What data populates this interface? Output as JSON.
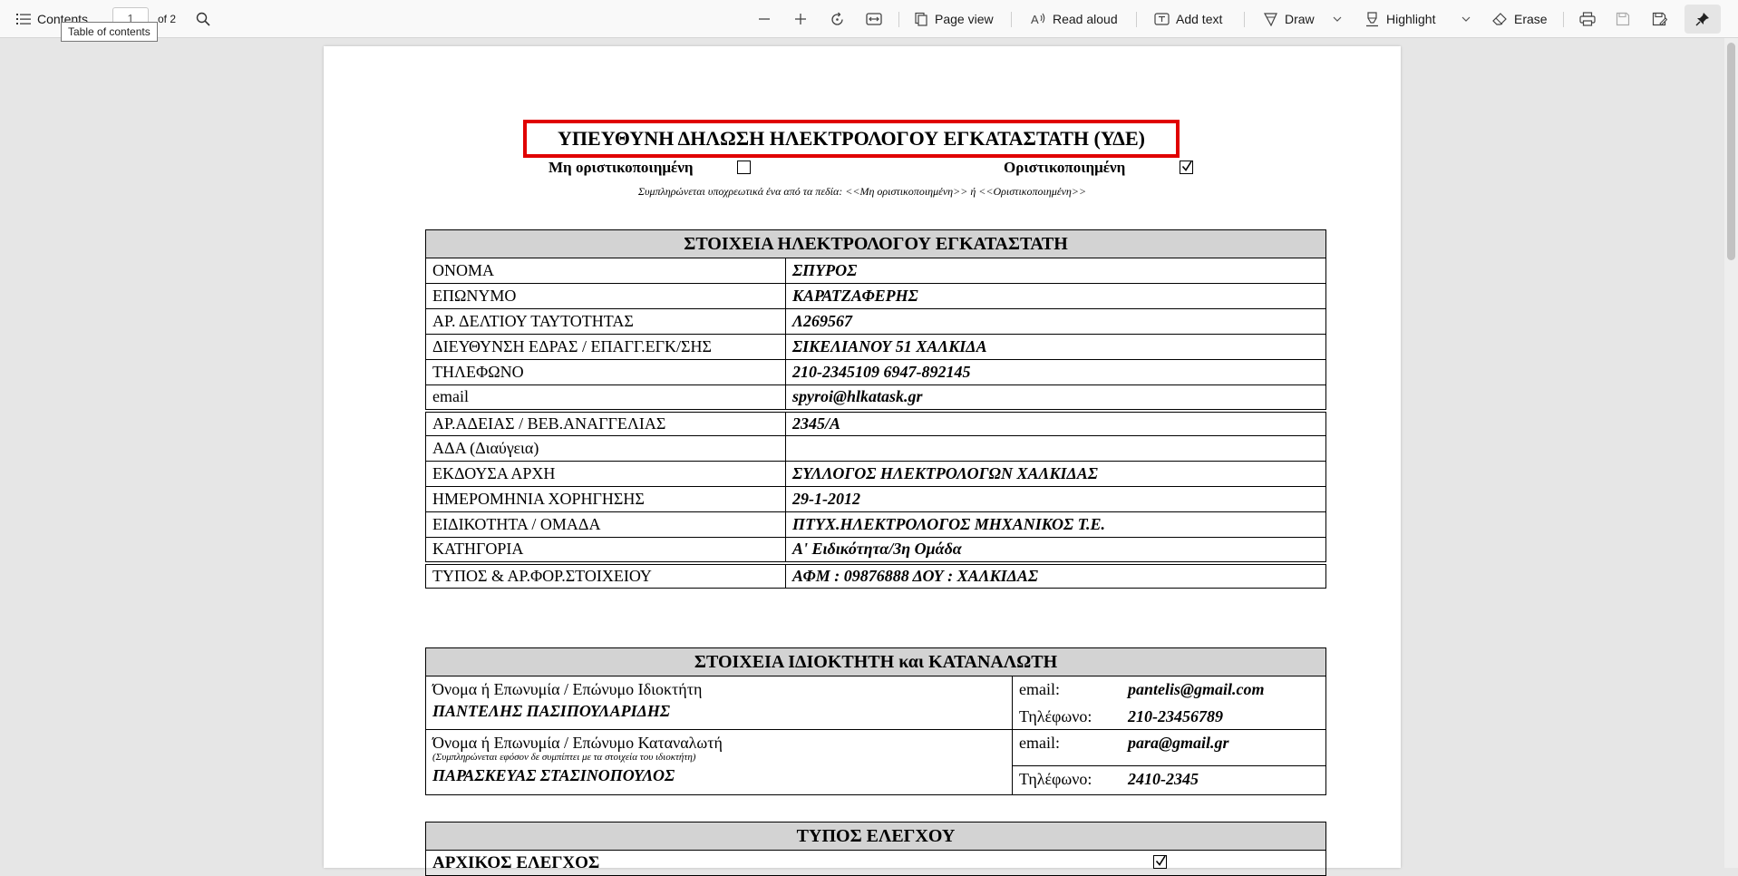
{
  "toolbar": {
    "contents_label": "Contents",
    "page_current": "1",
    "page_total": "of 2",
    "page_view": "Page view",
    "read_aloud": "Read aloud",
    "add_text": "Add text",
    "draw": "Draw",
    "highlight": "Highlight",
    "erase": "Erase",
    "tooltip": "Table of contents"
  },
  "doc": {
    "title": "ΥΠΕΥΘΥΝΗ ΔΗΛΩΣΗ ΗΛΕΚΤΡΟΛΟΓΟΥ ΕΓΚΑΤΑΣΤΑΤΗ (ΥΔΕ)",
    "not_finalized": "Μη οριστικοποιημένη",
    "finalized": "Οριστικοποιημένη",
    "fill_note": "Συμπληρώνεται υποχρεωτικά ένα από τα πεδία: <<Μη οριστικοποιημένη>> ή <<Οριστικοποιημένη>>",
    "installer": {
      "header": "ΣΤΟΙΧΕΙΑ ΗΛΕΚΤΡΟΛΟΓΟΥ ΕΓΚΑΤΑΣΤΑΤΗ",
      "rows": [
        {
          "label": "ΟΝΟΜΑ",
          "value": "ΣΠΥΡΟΣ"
        },
        {
          "label": "ΕΠΩΝΥΜΟ",
          "value": "ΚΑΡΑΤΖΑΦΕΡΗΣ"
        },
        {
          "label": "ΑΡ. ΔΕΛΤΙΟΥ ΤΑΥΤΟΤΗΤΑΣ",
          "value": "Λ269567"
        },
        {
          "label": "ΔΙΕΥΘΥΝΣΗ ΕΔΡΑΣ / ΕΠΑΓΓ.ΕΓΚ/ΣΗΣ",
          "value": "ΣΙΚΕΛΙΑΝΟΥ 51 ΧΑΛΚΙΔΑ"
        },
        {
          "label": "ΤΗΛΕΦΩΝΟ",
          "value": "210-2345109  6947-892145"
        },
        {
          "label": "email",
          "value": "spyroi@hlkatask.gr"
        },
        {
          "label": "ΑΡ.ΑΔΕΙΑΣ / ΒΕΒ.ΑΝΑΓΓΕΛΙΑΣ",
          "value": "2345/Α"
        },
        {
          "label": "ΑΔΑ (Διαύγεια)",
          "value": ""
        },
        {
          "label": "ΕΚΔΟΥΣΑ ΑΡΧΗ",
          "value": "ΣΥΛΛΟΓΟΣ ΗΛΕΚΤΡΟΛΟΓΩΝ ΧΑΛΚΙΔΑΣ"
        },
        {
          "label": "ΗΜΕΡΟΜΗΝΙΑ ΧΟΡΗΓΗΣΗΣ",
          "value": "29-1-2012"
        },
        {
          "label": "ΕΙΔΙΚΟΤΗΤΑ / ΟΜΑΔΑ",
          "value": "ΠΤΥΧ.ΗΛΕΚΤΡΟΛΟΓΟΣ ΜΗΧΑΝΙΚΟΣ Τ.Ε."
        },
        {
          "label": "ΚΑΤΗΓΟΡΙΑ",
          "value": "Α' Ειδικότητα/3η Ομάδα"
        },
        {
          "label": "ΤΥΠΟΣ & ΑΡ.ΦΟΡ.ΣΤΟΙΧΕΙΟΥ",
          "value": "ΑΦΜ : 09876888  ΔΟΥ : ΧΑΛΚΙΔΑΣ"
        }
      ]
    },
    "owner": {
      "header": "ΣΤΟΙΧΕΙΑ ΙΔΙΟΚΤΗΤΗ και ΚΑΤΑΝΑΛΩΤΗ",
      "owner_label": "Όνομα ή Επωνυμία / Επώνυμο Ιδιοκτήτη",
      "owner_name": "ΠΑΝΤΕΛΗΣ ΠΑΣΙΠΟΥΛΑΡΙΔΗΣ",
      "owner_email_label": "email:",
      "owner_email": "pantelis@gmail.com",
      "owner_phone_label": "Τηλέφωνο:",
      "owner_phone": "210-23456789",
      "consumer_label": "Όνομα ή Επωνυμία / Επώνυμο Καταναλωτή",
      "consumer_note": "(Συμπληρώνεται εφόσον δε συμπίπτει με τα στοιχεία του ιδιοκτήτη)",
      "consumer_name": "ΠΑΡΑΣΚΕΥΑΣ ΣΤΑΣΙΝΟΠΟΥΛΟΣ",
      "consumer_email_label": "email:",
      "consumer_email": "para@gmail.gr",
      "consumer_phone_label": "Τηλέφωνο:",
      "consumer_phone": "2410-2345"
    },
    "check_type": {
      "header": "ΤΥΠΟΣ ΕΛΕΓΧΟΥ",
      "first_row": "ΑΡΧΙΚΟΣ ΕΛΕΓΧΟΣ"
    }
  }
}
